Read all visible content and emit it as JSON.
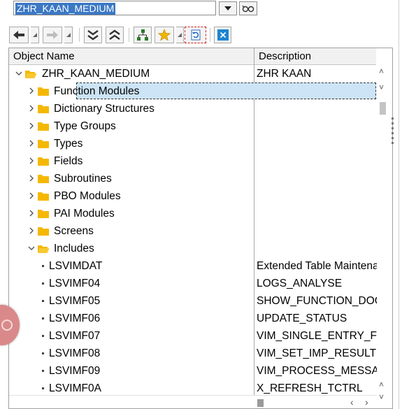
{
  "object_input": {
    "value": "ZHR_KAAN_MEDIUM"
  },
  "toolbar": {
    "buttons": [
      {
        "name": "back-button",
        "icon": "arrow-left-icon"
      },
      {
        "name": "forward-button",
        "icon": "arrow-right-icon"
      },
      {
        "name": "expand-all-button",
        "icon": "double-chevron-down-icon"
      },
      {
        "name": "collapse-all-button",
        "icon": "double-chevron-up-icon"
      },
      {
        "name": "hierarchy-button",
        "icon": "hierarchy-icon"
      },
      {
        "name": "favorites-button",
        "icon": "star-icon"
      },
      {
        "name": "refresh-button",
        "icon": "refresh-icon"
      },
      {
        "name": "close-button",
        "icon": "close-icon"
      }
    ]
  },
  "tree": {
    "columns": {
      "name": "Object Name",
      "description": "Description"
    },
    "rows": [
      {
        "name": "ZHR_KAAN_MEDIUM",
        "desc": "ZHR KAAN"
      },
      {
        "name": "Function Modules",
        "desc": ""
      },
      {
        "name": "Dictionary Structures",
        "desc": ""
      },
      {
        "name": "Type Groups",
        "desc": ""
      },
      {
        "name": "Types",
        "desc": ""
      },
      {
        "name": "Fields",
        "desc": ""
      },
      {
        "name": "Subroutines",
        "desc": ""
      },
      {
        "name": "PBO Modules",
        "desc": ""
      },
      {
        "name": "PAI Modules",
        "desc": ""
      },
      {
        "name": "Screens",
        "desc": ""
      },
      {
        "name": "Includes",
        "desc": ""
      },
      {
        "name": "LSVIMDAT",
        "desc": "Extended Table Maintena"
      },
      {
        "name": "LSVIMF04",
        "desc": "LOGS_ANALYSE"
      },
      {
        "name": "LSVIMF05",
        "desc": "SHOW_FUNCTION_DOC"
      },
      {
        "name": "LSVIMF06",
        "desc": "UPDATE_STATUS"
      },
      {
        "name": "LSVIMF07",
        "desc": "VIM_SINGLE_ENTRY_FI"
      },
      {
        "name": "LSVIMF08",
        "desc": "VIM_SET_IMP_RESULTS"
      },
      {
        "name": "LSVIMF09",
        "desc": "VIM_PROCESS_MESSAG"
      },
      {
        "name": "LSVIMF0A",
        "desc": "X_REFRESH_TCTRL"
      }
    ]
  },
  "colors": {
    "selection": "#3b78c5",
    "folder": "#f5b800",
    "row_highlight": "#cce4f5"
  }
}
